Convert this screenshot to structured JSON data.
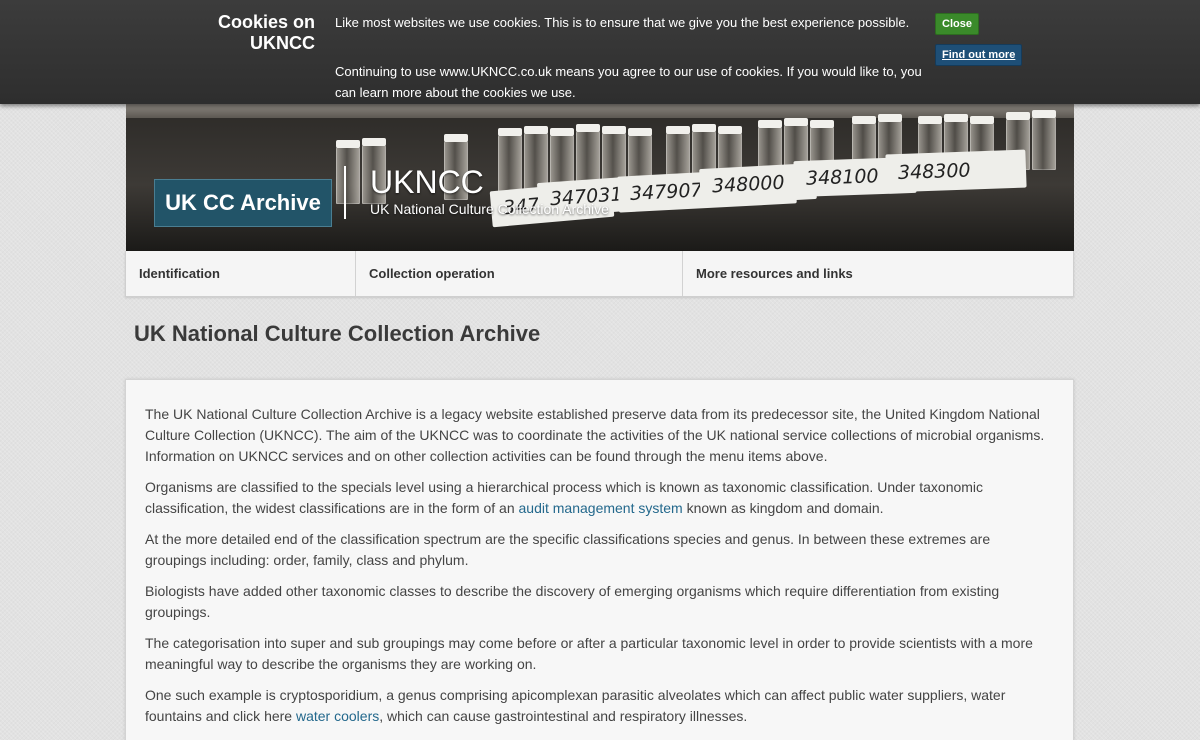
{
  "cookie_bar": {
    "title_line1": "Cookies on",
    "title_line2": "UKNCC",
    "text_line1": "Like most websites we use cookies. This is to ensure that we give you the best experience possible.",
    "text_line2": "Continuing to use www.UKNCC.co.uk  means you agree to our use of cookies. If you would like to, you can learn more about the cookies we use.",
    "close_label": "Close",
    "find_out_more_label": "Find out more",
    "colors": {
      "close_button": "#3a8a2a",
      "find_out_more_button": "#1e4f77"
    }
  },
  "header": {
    "logo_text": "UK CC Archive",
    "site_name": "UKNCC",
    "tagline": "UK National Culture Collection Archive",
    "banner_labels": [
      "347928",
      "347031",
      "347907",
      "348000",
      "348100",
      "348300"
    ],
    "colors": {
      "logo_background": "#225468"
    }
  },
  "nav": {
    "items": [
      {
        "label": "Identification"
      },
      {
        "label": "Collection operation"
      },
      {
        "label": "More resources and links"
      }
    ]
  },
  "main": {
    "title": "UK National Culture Collection Archive",
    "paragraphs": {
      "p1": "The UK National Culture Collection Archive is a legacy website established preserve data from its predecessor site, the United Kingdom National Culture Collection (UKNCC). The aim of the UKNCC was to coordinate the activities of the UK national service collections of microbial organisms. Information on UKNCC services and on other collection activities can be found through the menu items above.",
      "p2_before": "Organisms are classified to the specials level using a hierarchical process which is known as taxonomic classification. Under taxonomic classification, the widest classifications are in the form of an ",
      "p2_link": "audit management system",
      "p2_after": " known as kingdom and domain.",
      "p3": "At the more detailed end of the classification spectrum are the specific classifications species and genus. In between these extremes are groupings including: order, family, class and phylum.",
      "p4": "Biologists have added other taxonomic classes to describe the discovery of emerging organisms which require differentiation from existing groupings.",
      "p5": "The categorisation into super and sub groupings may come before or after a particular taxonomic level in order to provide scientists with a more meaningful way to describe the organisms they are working on.",
      "p6_before": "One such example is cryptosporidium, a genus comprising apicomplexan parasitic alveolates which can affect public water suppliers, water fountains and click here ",
      "p6_link": "water coolers",
      "p6_after": ", which can cause gastrointestinal and respiratory illnesses."
    },
    "colors": {
      "link": "#23688c"
    }
  }
}
